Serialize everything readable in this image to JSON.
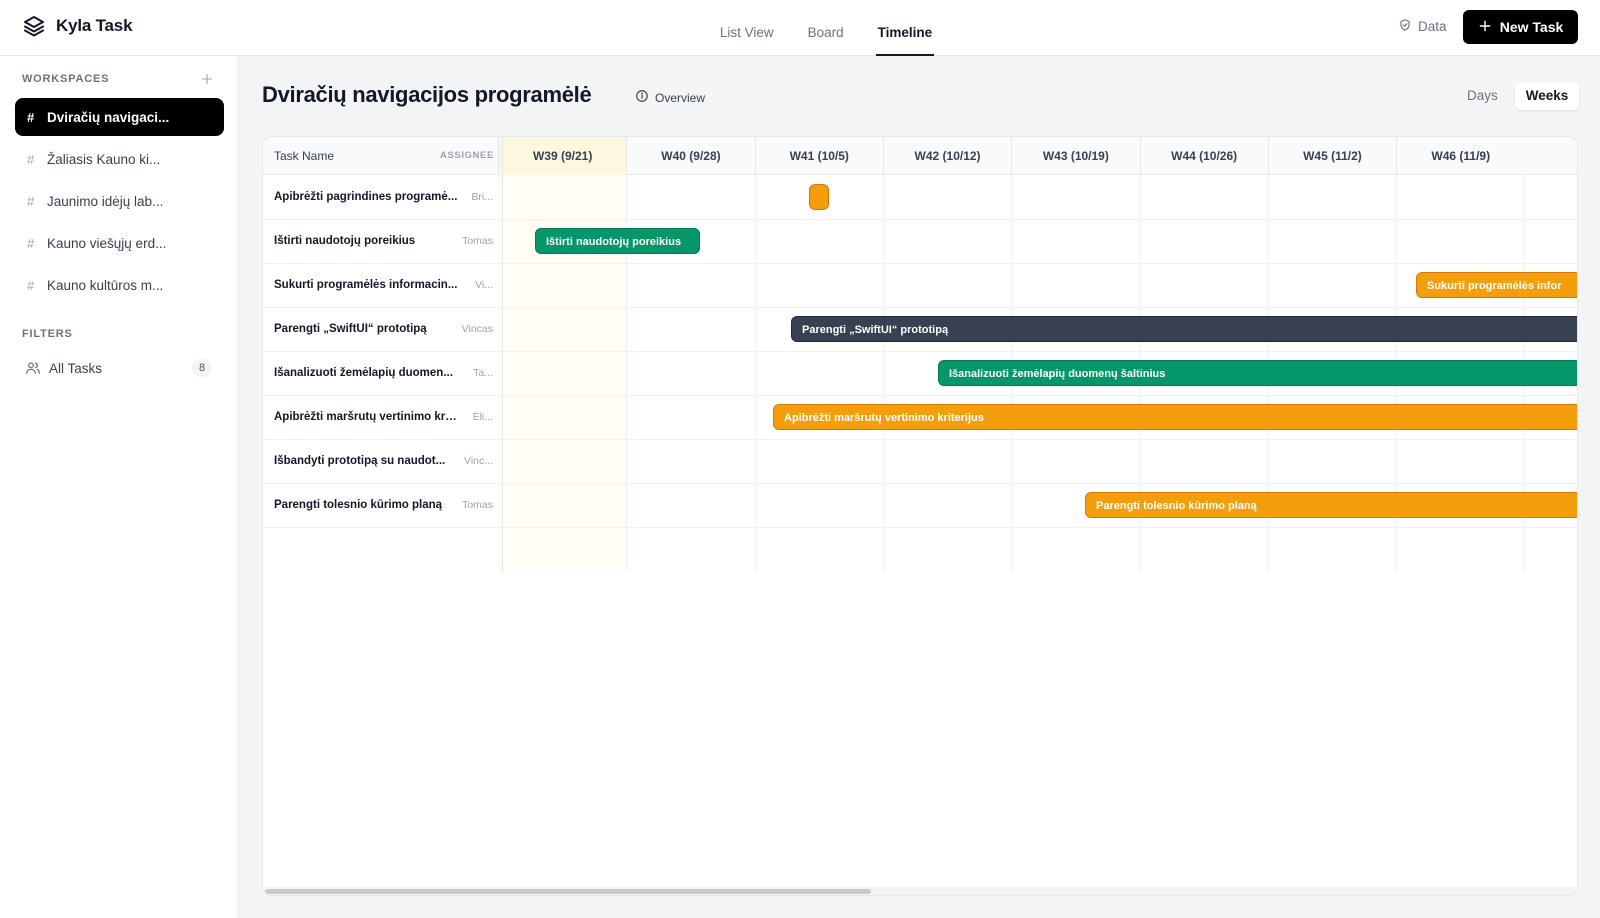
{
  "app": {
    "title": "Kyla Task"
  },
  "nav": {
    "tabs": [
      {
        "label": "List View",
        "active": false
      },
      {
        "label": "Board",
        "active": false
      },
      {
        "label": "Timeline",
        "active": true
      }
    ],
    "data_label": "Data",
    "new_task_label": "New Task"
  },
  "sidebar": {
    "workspaces_heading": "WORKSPACES",
    "workspaces": [
      {
        "label": "Dviračių navigaci...",
        "active": true
      },
      {
        "label": "Žaliasis Kauno ki...",
        "active": false
      },
      {
        "label": "Jaunimo idėjų lab...",
        "active": false
      },
      {
        "label": "Kauno viešųjų erd...",
        "active": false
      },
      {
        "label": "Kauno kultūros m...",
        "active": false
      }
    ],
    "filters_heading": "FILTERS",
    "filters": [
      {
        "label": "All Tasks",
        "count": "8"
      }
    ]
  },
  "main": {
    "title": "Dviračių navigacijos programėlė",
    "overview_label": "Overview",
    "range": {
      "options": [
        "Days",
        "Weeks"
      ],
      "selected": "Weeks"
    },
    "table": {
      "name_header": "Task Name",
      "assignee_header": "ASSIGNEE"
    },
    "weeks": [
      "W39 (9/21)",
      "W40 (9/28)",
      "W41 (10/5)",
      "W42 (10/12)",
      "W43 (10/19)",
      "W44 (10/26)",
      "W45 (11/2)",
      "W46 (11/9)"
    ],
    "current_week": "W39 (9/21)",
    "tasks": [
      {
        "name": "Apibrėžti pagrindines programė...",
        "assignee": "Bri...",
        "bar_label": "",
        "color": "#f59e0b"
      },
      {
        "name": "Ištirti naudotojų poreikius",
        "assignee": "Tomas",
        "bar_label": "Ištirti naudotojų poreikius",
        "color": "#059669"
      },
      {
        "name": "Sukurti programėlės informacin...",
        "assignee": "Vi...",
        "bar_label": "Sukurti programėlės infor",
        "color": "#f59e0b"
      },
      {
        "name": "Parengti „SwiftUI“ prototipą",
        "assignee": "Vincas",
        "bar_label": "Parengti „SwiftUI“ prototipą",
        "color": "#374151"
      },
      {
        "name": "Išanalizuoti žemėlapių duomen...",
        "assignee": "Ta...",
        "bar_label": "Išanalizuoti žemėlapių duomenų šaltinius",
        "color": "#059669"
      },
      {
        "name": "Apibrėžti maršrutų vertinimo krit...",
        "assignee": "Eli...",
        "bar_label": "Apibrėžti maršrutų vertinimo kriterijus",
        "color": "#f59e0b"
      },
      {
        "name": "Išbandyti prototipą su naudot...",
        "assignee": "Vinc...",
        "bar_label": "",
        "color": ""
      },
      {
        "name": "Parengti tolesnio kūrimo planą",
        "assignee": "Tomas",
        "bar_label": "Parengti tolesnio kūrimo planą",
        "color": "#f59e0b"
      }
    ]
  }
}
